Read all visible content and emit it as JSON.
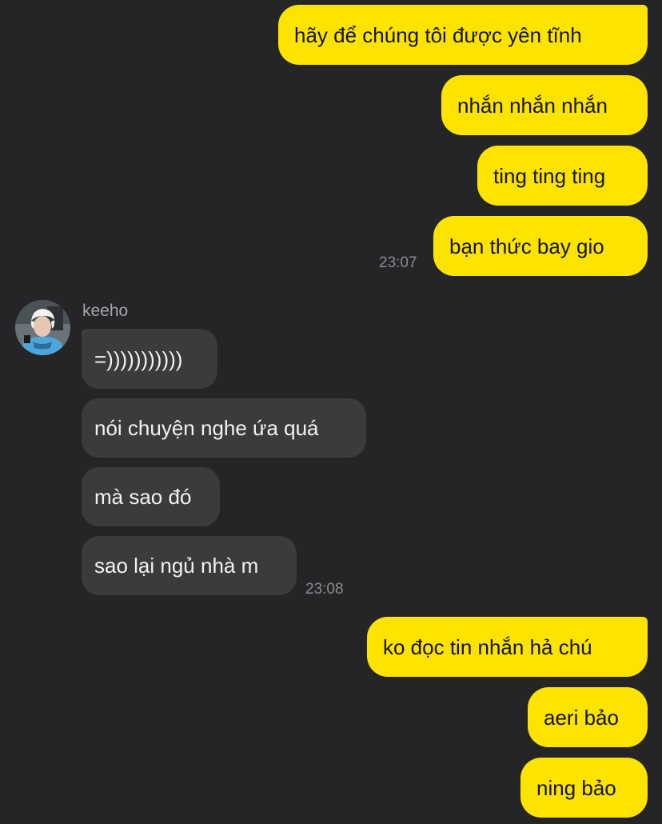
{
  "sent_top": [
    {
      "text": "hãy để chúng tôi được yên tĩnh"
    },
    {
      "text": "nhắn nhắn nhắn"
    },
    {
      "text": "ting ting ting"
    },
    {
      "text": "bạn thức bay gio"
    }
  ],
  "sent_top_time": "23:07",
  "received": {
    "sender": "keeho",
    "avatar_icon": "profile-photo-avatar",
    "messages": [
      {
        "text": "=)))))))))))"
      },
      {
        "text": "nói chuyện nghe ứa quá"
      },
      {
        "text": "mà sao đó"
      },
      {
        "text": "sao lại ngủ nhà m"
      }
    ],
    "time": "23:08"
  },
  "sent_bottom": [
    {
      "text": "ko đọc tin nhắn hả chú"
    },
    {
      "text": "aeri bảo"
    },
    {
      "text": "ning bảo"
    }
  ],
  "colors": {
    "background": "#252527",
    "outgoing_bubble": "#fde300",
    "incoming_bubble": "#3b3b3d"
  }
}
